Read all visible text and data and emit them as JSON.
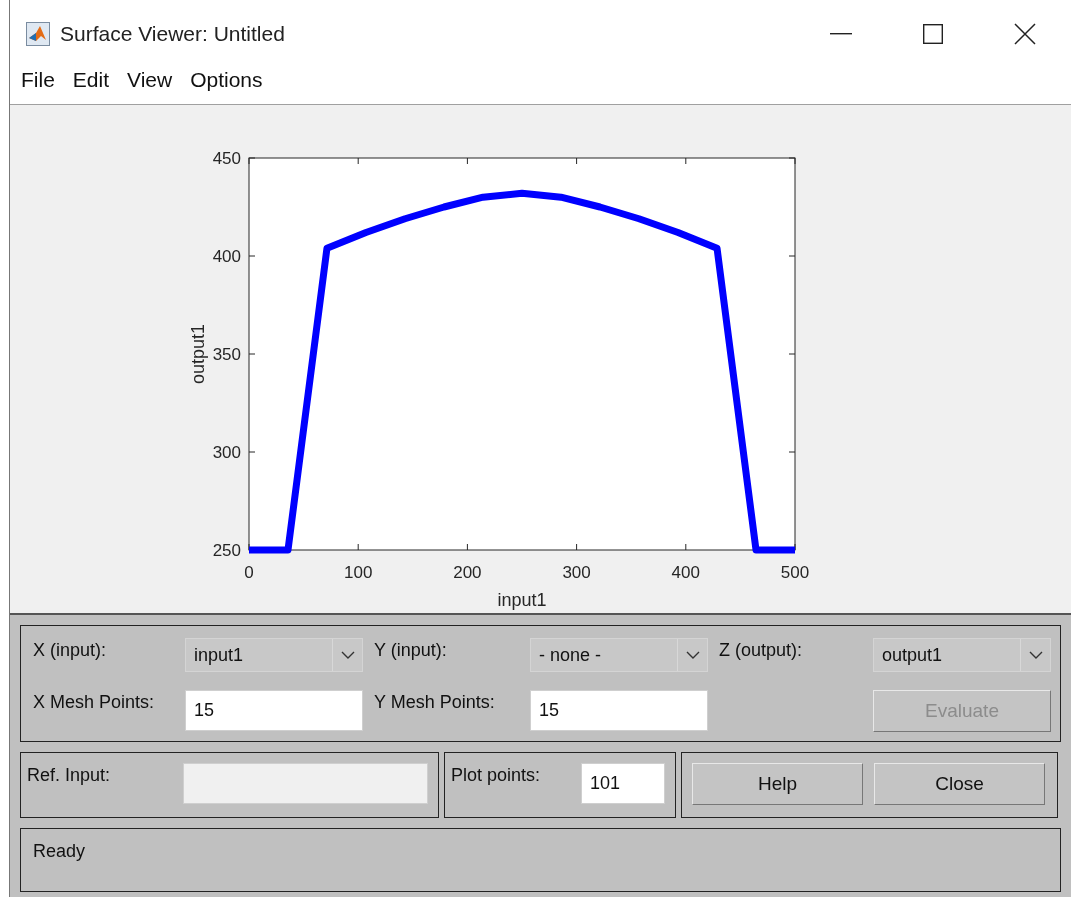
{
  "window": {
    "title": "Surface Viewer: Untitled"
  },
  "menu": [
    {
      "label": "File"
    },
    {
      "label": "Edit"
    },
    {
      "label": "View"
    },
    {
      "label": "Options"
    }
  ],
  "plot": {
    "chart_data": {
      "type": "line",
      "xlabel": "input1",
      "ylabel": "output1",
      "x": [
        0,
        35.7,
        71.4,
        107.1,
        142.9,
        178.6,
        214.3,
        250,
        285.7,
        321.4,
        357.1,
        392.9,
        428.6,
        464.3,
        500
      ],
      "series": [
        {
          "color": "#0000ff",
          "values": [
            250,
            250,
            404,
            412,
            419,
            425,
            430,
            432,
            430,
            425,
            419,
            412,
            404,
            250,
            250
          ]
        }
      ],
      "xlim": [
        0,
        500
      ],
      "ylim": [
        250,
        450
      ],
      "xticks": [
        0,
        100,
        200,
        300,
        400,
        500
      ],
      "yticks": [
        250,
        300,
        350,
        400,
        450
      ]
    }
  },
  "axis_selectors": [
    {
      "label": "X (input):",
      "value": "input1"
    },
    {
      "label": "Y (input):",
      "value": "- none -"
    },
    {
      "label": "Z (output):",
      "value": "output1"
    }
  ],
  "mesh_points": [
    {
      "label": "X Mesh Points:",
      "value": "15"
    },
    {
      "label": "Y Mesh Points:",
      "value": "15"
    }
  ],
  "evaluate_button": {
    "label": "Evaluate",
    "disabled": true
  },
  "ref_input": {
    "label": "Ref. Input:",
    "disabled": true
  },
  "plot_points": {
    "label": "Plot points:",
    "value": "101"
  },
  "buttons": [
    {
      "label": "Help"
    },
    {
      "label": "Close"
    }
  ],
  "status_bar": "Ready"
}
